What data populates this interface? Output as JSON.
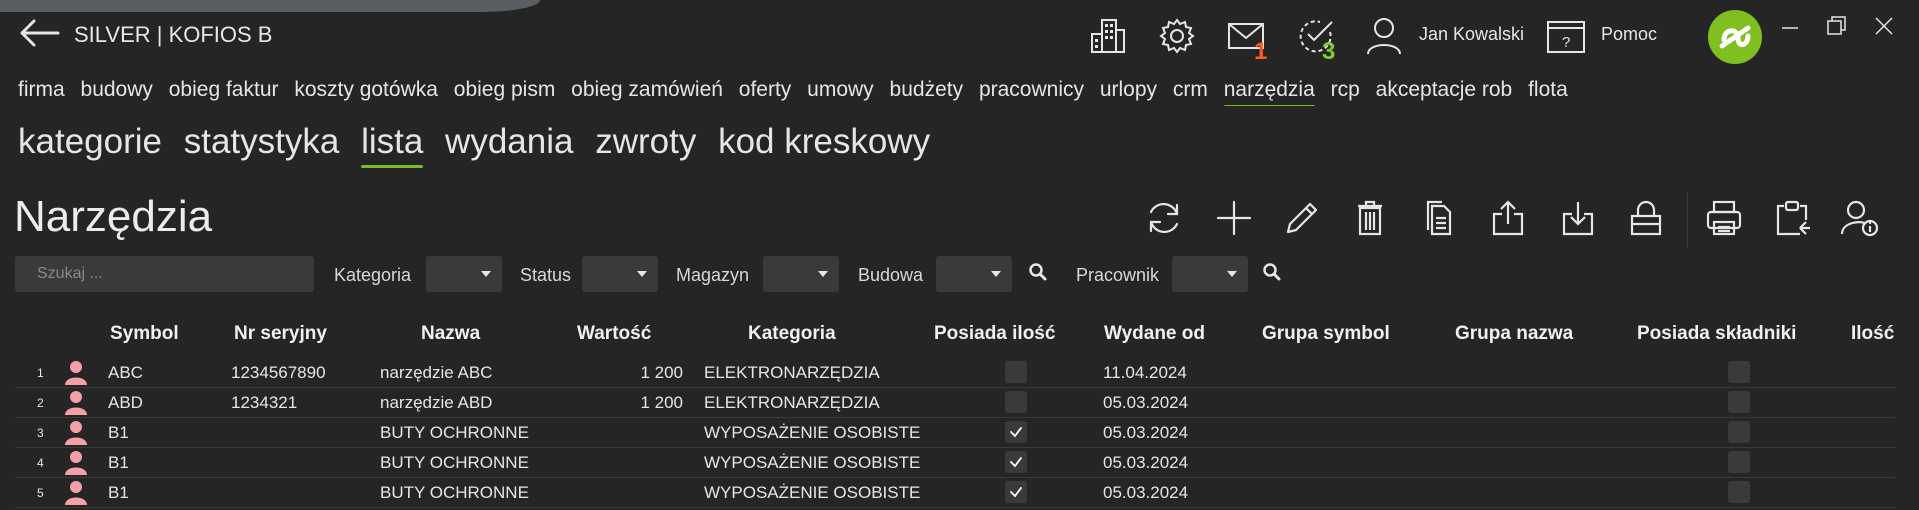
{
  "header": {
    "app_title": "SILVER | KOFIOS B",
    "icons": [
      "building-icon",
      "gear-icon",
      "mail-icon",
      "tasks-icon",
      "user-icon",
      "help-icon"
    ],
    "mail_badge": "1",
    "tasks_badge": "3",
    "user_name": "Jan Kowalski",
    "help_label": "Pomoc",
    "colors": {
      "mail_badge": "#ff5a1f",
      "tasks_badge": "#7dd02a",
      "logo": "#7fbf1f",
      "accent": "#7dbb22",
      "avatar": "#f4a0a8"
    }
  },
  "modules": [
    "firma",
    "budowy",
    "obieg faktur",
    "koszty gotówka",
    "obieg pism",
    "obieg zamówień",
    "oferty",
    "umowy",
    "budżety",
    "pracownicy",
    "urlopy",
    "crm",
    "narzędzia",
    "rcp",
    "akceptacje rob",
    "flota"
  ],
  "active_module": "narzędzia",
  "subnav": [
    "kategorie",
    "statystyka",
    "lista",
    "wydania",
    "zwroty",
    "kod kreskowy"
  ],
  "active_subnav": "lista",
  "page_title": "Narzędzia",
  "toolbar": [
    "refresh-icon",
    "add-icon",
    "edit-icon",
    "delete-icon",
    "copy-icon",
    "export-icon",
    "import-icon",
    "lock-icon",
    "print-icon",
    "clipboard-icon",
    "user-info-icon"
  ],
  "filters": {
    "search_placeholder": "Szukaj ...",
    "kategoria": "Kategoria",
    "status": "Status",
    "magazyn": "Magazyn",
    "budowa": "Budowa",
    "pracownik": "Pracownik"
  },
  "table": {
    "columns": [
      "Symbol",
      "Nr seryjny",
      "Nazwa",
      "Wartość",
      "Kategoria",
      "Posiada ilość",
      "Wydane od",
      "Grupa symbol",
      "Grupa nazwa",
      "Posiada składniki",
      "Ilość"
    ],
    "rows": [
      {
        "num": "1",
        "symbol": "ABC",
        "serial": "1234567890",
        "name": "narzędzie ABC",
        "value": "1 200",
        "category": "ELEKTRONARZĘDZIA",
        "has_qty": false,
        "issued": "11.04.2024"
      },
      {
        "num": "2",
        "symbol": "ABD",
        "serial": "1234321",
        "name": "narzędzie ABD",
        "value": "1 200",
        "category": "ELEKTRONARZĘDZIA",
        "has_qty": false,
        "issued": "05.03.2024"
      },
      {
        "num": "3",
        "symbol": "B1",
        "serial": "",
        "name": "BUTY OCHRONNE",
        "value": "",
        "category": "WYPOSAŻENIE OSOBISTE",
        "has_qty": true,
        "issued": "05.03.2024"
      },
      {
        "num": "4",
        "symbol": "B1",
        "serial": "",
        "name": "BUTY OCHRONNE",
        "value": "",
        "category": "WYPOSAŻENIE OSOBISTE",
        "has_qty": true,
        "issued": "05.03.2024"
      },
      {
        "num": "5",
        "symbol": "B1",
        "serial": "",
        "name": "BUTY OCHRONNE",
        "value": "",
        "category": "WYPOSAŻENIE OSOBISTE",
        "has_qty": true,
        "issued": "05.03.2024"
      }
    ]
  }
}
